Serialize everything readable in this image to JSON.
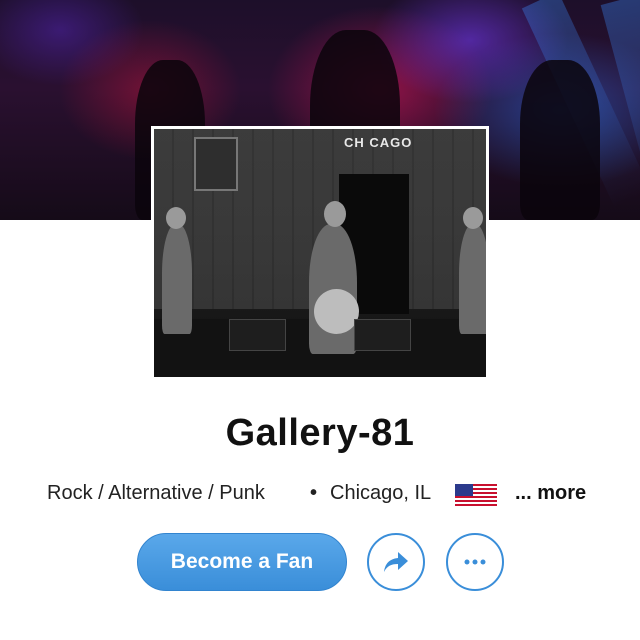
{
  "cover": {
    "image_description_icon": "concert-stage-cover-image"
  },
  "profile_photo": {
    "sign_text": "CH CAGO",
    "icon": "band-photo"
  },
  "artist": {
    "name": "Gallery-81"
  },
  "meta": {
    "genres": "Rock / Alternative / Punk",
    "separator": "•",
    "location": "Chicago, IL",
    "flag_icon": "us-flag-icon",
    "more_label": "... more"
  },
  "actions": {
    "fan_button_label": "Become a Fan",
    "share_icon": "share-arrow-icon",
    "more_icon": "ellipsis-icon"
  },
  "colors": {
    "accent": "#3a8ed9",
    "text": "#111111"
  }
}
